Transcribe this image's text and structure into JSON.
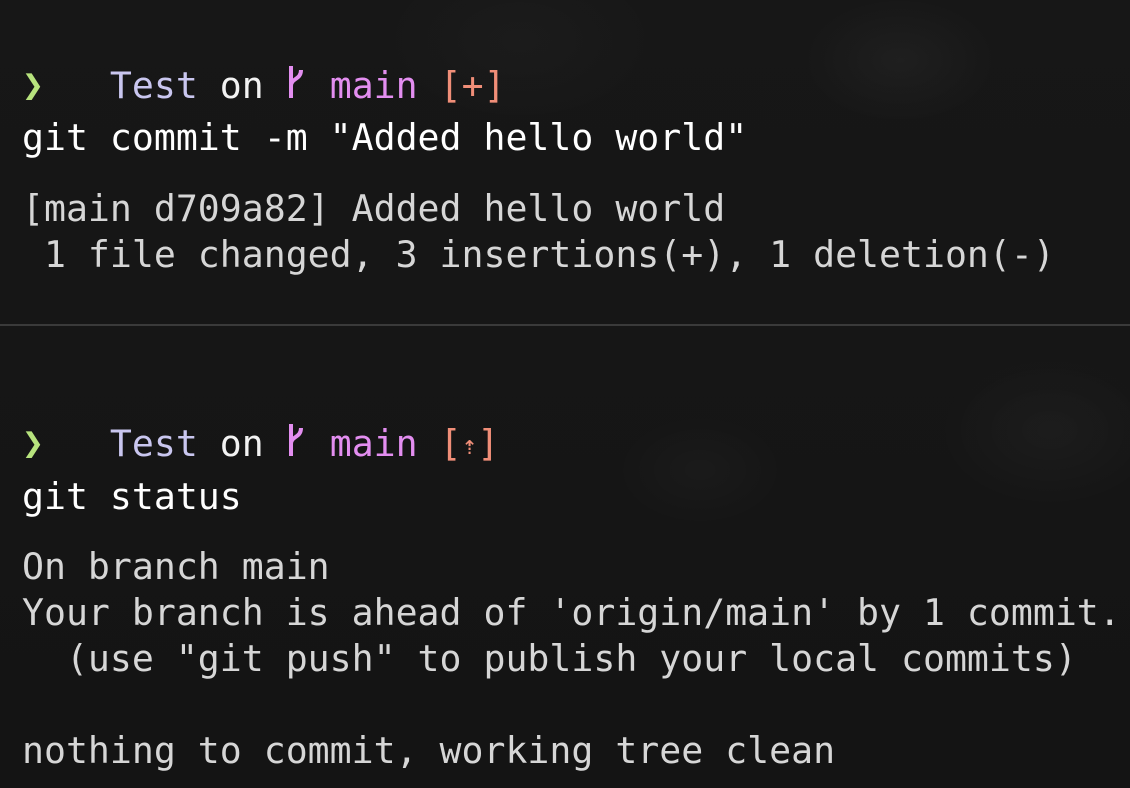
{
  "blocks": [
    {
      "prompt": {
        "dir": "Test",
        "on": "on",
        "branch_icon": "git-branch-icon",
        "branch": "main",
        "state_open": "[",
        "state_symbol": "+",
        "state_close": "]",
        "prompt_char": "❯"
      },
      "command": "git commit -m \"Added hello world\"",
      "output": [
        "[main d709a82] Added hello world",
        " 1 file changed, 3 insertions(+), 1 deletion(-)"
      ]
    },
    {
      "prompt": {
        "dir": "Test",
        "on": "on",
        "branch_icon": "git-branch-icon",
        "branch": "main",
        "state_open": "[",
        "state_symbol": "⇡",
        "state_close": "]",
        "prompt_char": "❯"
      },
      "command": "git status",
      "output": [
        "On branch main",
        "Your branch is ahead of 'origin/main' by 1 commit.",
        "  (use \"git push\" to publish your local commits)",
        "",
        "nothing to commit, working tree clean"
      ]
    }
  ],
  "colors": {
    "background": "#161616",
    "dir": "#c9c6ef",
    "branch": "#e38ef0",
    "git_state": "#f08e78",
    "prompt_char": "#b7e37d",
    "command": "#ffffff",
    "output": "#d6d6d6",
    "divider": "#3a3a3a"
  }
}
